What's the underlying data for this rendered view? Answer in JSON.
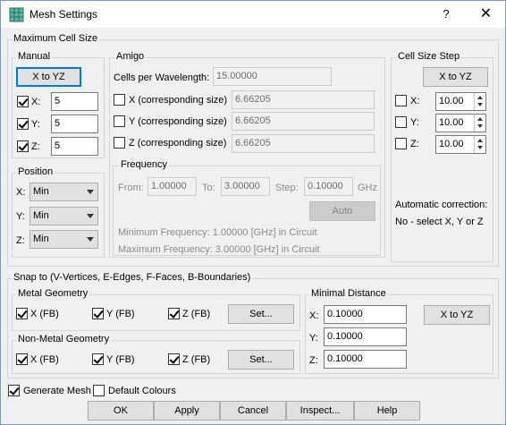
{
  "window": {
    "title": "Mesh Settings",
    "help_label": "?",
    "close_label": "✕",
    "app_icon": "mesh-grid-icon"
  },
  "max_cell_size": {
    "label": "Maximum Cell Size",
    "manual": {
      "label": "Manual",
      "x_to_yz_label": "X to YZ",
      "x_label": "X:",
      "x_value": "5",
      "x_checked": true,
      "y_label": "Y:",
      "y_value": "5",
      "y_checked": true,
      "z_label": "Z:",
      "z_value": "5",
      "z_checked": true
    },
    "position": {
      "label": "Position",
      "x_label": "X:",
      "x_value": "Min",
      "y_label": "Y:",
      "y_value": "Min",
      "z_label": "Z:",
      "z_value": "Min"
    },
    "amigo": {
      "label": "Amigo",
      "cells_per_wavelength_label": "Cells per Wavelength:",
      "cells_per_wavelength_value": "15.00000",
      "x_label": "X (corresponding size)",
      "x_value": "6.66205",
      "y_label": "Y (corresponding size)",
      "y_value": "6.66205",
      "z_label": "Z (corresponding size)",
      "z_value": "6.66205",
      "frequency": {
        "label": "Frequency",
        "from_label": "From:",
        "from_value": "1.00000",
        "to_label": "To:",
        "to_value": "3.00000",
        "step_label": "Step:",
        "step_value": "0.10000",
        "unit": "GHz",
        "auto_label": "Auto",
        "min_text": "Minimum Frequency: 1.00000 [GHz] in Circuit",
        "max_text": "Maximum Frequency: 3.00000 [GHz] in Circuit"
      }
    },
    "cell_size_step": {
      "label": "Cell Size Step",
      "x_to_yz_label": "X to YZ",
      "x_label": "X:",
      "x_value": "10.00",
      "y_label": "Y:",
      "y_value": "10.00",
      "z_label": "Z:",
      "z_value": "10.00",
      "auto_correction_label": "Automatic correction:",
      "auto_correction_text": "No - select X, Y or Z"
    }
  },
  "snap": {
    "label": "Snap to (V-Vertices, E-Edges, F-Faces, B-Boundaries)",
    "metal": {
      "label": "Metal Geometry",
      "x_label": "X (FB)",
      "y_label": "Y (FB)",
      "z_label": "Z (FB)",
      "set_label": "Set..."
    },
    "non_metal": {
      "label": "Non-Metal Geometry",
      "x_label": "X (FB)",
      "y_label": "Y (FB)",
      "z_label": "Z (FB)",
      "set_label": "Set..."
    },
    "minimal_distance": {
      "label": "Minimal Distance",
      "x_label": "X:",
      "x_value": "0.10000",
      "y_label": "Y:",
      "y_value": "0.10000",
      "z_label": "Z:",
      "z_value": "0.10000",
      "x_to_yz_label": "X to YZ"
    }
  },
  "footer": {
    "generate_mesh_label": "Generate Mesh",
    "default_colours_label": "Default Colours",
    "ok_label": "OK",
    "apply_label": "Apply",
    "cancel_label": "Cancel",
    "inspect_label": "Inspect...",
    "help_label": "Help"
  }
}
